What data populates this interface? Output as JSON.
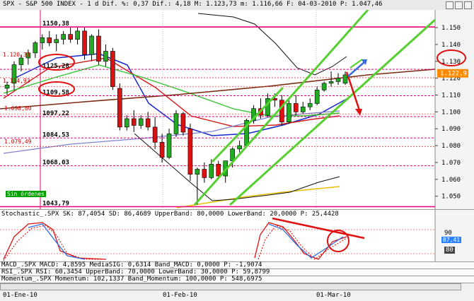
{
  "header": {
    "title_text": "SPX - S&P 500 INDEX - 1 d Dif. %: 0,37 Dif.: 4,18 M: 1.123,73 m: 1.116,66 F: 04-03-2010 P: 1.047,46"
  },
  "price_axis": {
    "ticks": [
      "1.150",
      "1.140",
      "1.130",
      "1.120",
      "1.110",
      "1.100",
      "1.090",
      "1.080",
      "1.070",
      "1.060",
      "1.050"
    ],
    "current_price": "1.122,9"
  },
  "levels": [
    {
      "label": "1150,38",
      "value": 1150.38,
      "color": "#e8007a"
    },
    {
      "label": "1125,28",
      "value": 1125.28,
      "color": "#e8007a"
    },
    {
      "label": "1109,58",
      "value": 1109.58,
      "color": "#e8007a"
    },
    {
      "label": "1097,22",
      "value": 1097.22,
      "color": "#e8007a"
    },
    {
      "label": "1084,53",
      "value": 1084.53,
      "color": "#e8007a"
    },
    {
      "label": "1068,03",
      "value": 1068.03,
      "color": "#e8007a"
    },
    {
      "label": "1043,79",
      "value": 1043.79,
      "color": "#e8007a"
    }
  ],
  "side_labels": [
    "1.120,31",
    "1.114,93",
    "1.098,80",
    "1.079,49"
  ],
  "annotation": "Sin órdenes",
  "stochastic": {
    "header": "Stochastic_.SPX SK: 87,4054 SD: 86,4689 UpperBand: 80,0000 LowerBand: 20,0000 P: 25,4428",
    "ticks": [
      "90",
      "80"
    ],
    "value_label": "87,41"
  },
  "macd": {
    "header": "MACD_.SPX MACD: 4,8595 MediaSIG: 0,6314 Band_MACD: 0,0000 P: -1,9074"
  },
  "rsi": {
    "header": "RSI_.SPX RSI: 60,3454 UpperBand: 70,0000 LowerBand: 30,0000 P: 59,8799"
  },
  "momentum": {
    "header": "Momentum_.SPX Momentum: 102,1337 Band_Momentum: 100,0000 P: 548,6975"
  },
  "time_axis": [
    "01-Ene-10",
    "01-Feb-10",
    "01-Mar-10"
  ],
  "colors": {
    "up": "#22aa22",
    "down": "#dd1111",
    "channel": "#55d030",
    "level": "#e8007a"
  },
  "chart_data": {
    "type": "candlestick",
    "ylim": [
      1044,
      1158
    ],
    "candles": [
      {
        "o": 1114,
        "h": 1118,
        "l": 1110,
        "c": 1116
      },
      {
        "o": 1117,
        "h": 1130,
        "l": 1113,
        "c": 1128
      },
      {
        "o": 1128,
        "h": 1134,
        "l": 1124,
        "c": 1132
      },
      {
        "o": 1132,
        "h": 1137,
        "l": 1128,
        "c": 1135
      },
      {
        "o": 1135,
        "h": 1142,
        "l": 1132,
        "c": 1141
      },
      {
        "o": 1141,
        "h": 1146,
        "l": 1137,
        "c": 1144
      },
      {
        "o": 1144,
        "h": 1148,
        "l": 1139,
        "c": 1141
      },
      {
        "o": 1141,
        "h": 1146,
        "l": 1136,
        "c": 1143
      },
      {
        "o": 1143,
        "h": 1148,
        "l": 1140,
        "c": 1146
      },
      {
        "o": 1146,
        "h": 1150,
        "l": 1141,
        "c": 1143
      },
      {
        "o": 1143,
        "h": 1150,
        "l": 1140,
        "c": 1148
      },
      {
        "o": 1148,
        "h": 1150,
        "l": 1131,
        "c": 1134
      },
      {
        "o": 1134,
        "h": 1146,
        "l": 1130,
        "c": 1145
      },
      {
        "o": 1145,
        "h": 1149,
        "l": 1128,
        "c": 1130
      },
      {
        "o": 1130,
        "h": 1140,
        "l": 1127,
        "c": 1136
      },
      {
        "o": 1136,
        "h": 1138,
        "l": 1113,
        "c": 1115
      },
      {
        "o": 1114,
        "h": 1117,
        "l": 1089,
        "c": 1091
      },
      {
        "o": 1091,
        "h": 1098,
        "l": 1089,
        "c": 1096
      },
      {
        "o": 1096,
        "h": 1101,
        "l": 1088,
        "c": 1092
      },
      {
        "o": 1092,
        "h": 1098,
        "l": 1090,
        "c": 1096
      },
      {
        "o": 1096,
        "h": 1100,
        "l": 1089,
        "c": 1091
      },
      {
        "o": 1091,
        "h": 1097,
        "l": 1078,
        "c": 1082
      },
      {
        "o": 1082,
        "h": 1087,
        "l": 1070,
        "c": 1073
      },
      {
        "o": 1073,
        "h": 1090,
        "l": 1072,
        "c": 1087
      },
      {
        "o": 1087,
        "h": 1101,
        "l": 1085,
        "c": 1099
      },
      {
        "o": 1099,
        "h": 1100,
        "l": 1086,
        "c": 1088
      },
      {
        "o": 1090,
        "h": 1093,
        "l": 1059,
        "c": 1063
      },
      {
        "o": 1063,
        "h": 1067,
        "l": 1045,
        "c": 1066
      },
      {
        "o": 1066,
        "h": 1070,
        "l": 1058,
        "c": 1061
      },
      {
        "o": 1061,
        "h": 1072,
        "l": 1060,
        "c": 1069
      },
      {
        "o": 1069,
        "h": 1071,
        "l": 1060,
        "c": 1062
      },
      {
        "o": 1062,
        "h": 1071,
        "l": 1058,
        "c": 1071
      },
      {
        "o": 1071,
        "h": 1079,
        "l": 1067,
        "c": 1078
      },
      {
        "o": 1078,
        "h": 1083,
        "l": 1076,
        "c": 1080
      },
      {
        "o": 1080,
        "h": 1096,
        "l": 1079,
        "c": 1095
      },
      {
        "o": 1095,
        "h": 1104,
        "l": 1093,
        "c": 1102
      },
      {
        "o": 1102,
        "h": 1108,
        "l": 1096,
        "c": 1098
      },
      {
        "o": 1098,
        "h": 1111,
        "l": 1097,
        "c": 1108
      },
      {
        "o": 1108,
        "h": 1111,
        "l": 1103,
        "c": 1107
      },
      {
        "o": 1107,
        "h": 1110,
        "l": 1092,
        "c": 1094
      },
      {
        "o": 1094,
        "h": 1107,
        "l": 1093,
        "c": 1105
      },
      {
        "o": 1105,
        "h": 1110,
        "l": 1098,
        "c": 1100
      },
      {
        "o": 1100,
        "h": 1106,
        "l": 1099,
        "c": 1103
      },
      {
        "o": 1103,
        "h": 1108,
        "l": 1101,
        "c": 1105
      },
      {
        "o": 1105,
        "h": 1115,
        "l": 1104,
        "c": 1113
      },
      {
        "o": 1113,
        "h": 1118,
        "l": 1112,
        "c": 1117
      },
      {
        "o": 1117,
        "h": 1124,
        "l": 1115,
        "c": 1118
      },
      {
        "o": 1118,
        "h": 1123,
        "l": 1116,
        "c": 1120
      },
      {
        "o": 1117,
        "h": 1124,
        "l": 1116,
        "c": 1122
      }
    ]
  }
}
